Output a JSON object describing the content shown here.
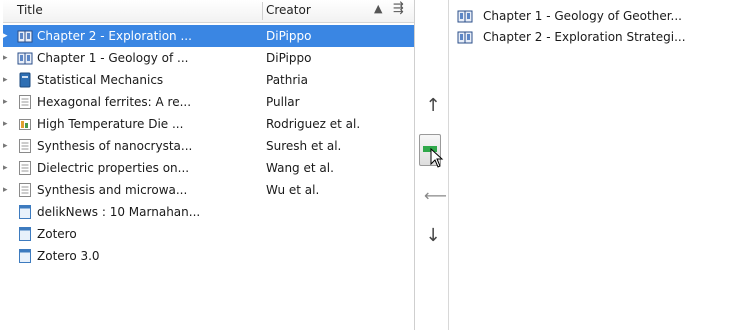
{
  "header": {
    "title_col": "Title",
    "creator_col": "Creator"
  },
  "items": [
    {
      "title": "Chapter 2 - Exploration ...",
      "creator": "DiPippo",
      "icon": "book-section-icon",
      "twisty": "▸",
      "selected": true
    },
    {
      "title": "Chapter 1 - Geology of ...",
      "creator": "DiPippo",
      "icon": "book-section-icon",
      "twisty": "▸",
      "selected": false
    },
    {
      "title": "Statistical Mechanics",
      "creator": "Pathria",
      "icon": "book-icon",
      "twisty": "▸",
      "selected": false
    },
    {
      "title": "Hexagonal ferrites: A re...",
      "creator": "Pullar",
      "icon": "journal-article-icon",
      "twisty": "▸",
      "selected": false
    },
    {
      "title": "High Temperature Die ...",
      "creator": "Rodriguez et al.",
      "icon": "report-icon",
      "twisty": "▸",
      "selected": false
    },
    {
      "title": "Synthesis of nanocrysta...",
      "creator": "Suresh et al.",
      "icon": "journal-article-icon",
      "twisty": "▸",
      "selected": false
    },
    {
      "title": "Dielectric properties on...",
      "creator": "Wang et al.",
      "icon": "journal-article-icon",
      "twisty": "▸",
      "selected": false
    },
    {
      "title": "Synthesis and microwa...",
      "creator": "Wu et al.",
      "icon": "journal-article-icon",
      "twisty": "▸",
      "selected": false
    },
    {
      "title": "delikNews : 10 Marnahan...",
      "creator": "",
      "icon": "webpage-icon",
      "twisty": "",
      "selected": false
    },
    {
      "title": "Zotero",
      "creator": "",
      "icon": "webpage-icon",
      "twisty": "",
      "selected": false
    },
    {
      "title": "Zotero 3.0",
      "creator": "",
      "icon": "webpage-icon",
      "twisty": "",
      "selected": false
    }
  ],
  "controls": {
    "up_glyph": "↑",
    "down_glyph": "↓",
    "remove_glyph": "⟵"
  },
  "right_list": [
    {
      "label": "Chapter 1 - Geology of Geother...",
      "icon": "book-section-icon"
    },
    {
      "label": "Chapter 2 - Exploration Strategi...",
      "icon": "book-section-icon"
    }
  ],
  "colors": {
    "selection": "#3a86e3",
    "add_button_green": "#2fa84a"
  }
}
